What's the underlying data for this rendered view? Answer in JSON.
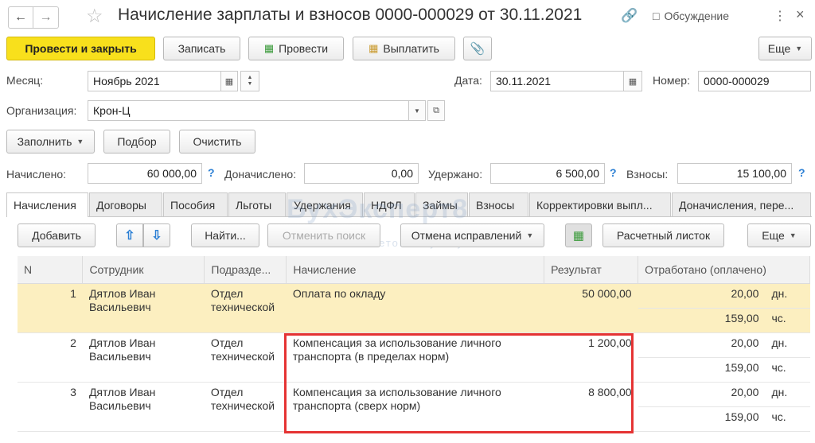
{
  "title": "Начисление зарплаты и взносов 0000-000029 от 30.11.2021",
  "header": {
    "discuss": "Обсуждение"
  },
  "toolbar": {
    "post_close": "Провести и закрыть",
    "save": "Записать",
    "post": "Провести",
    "pay": "Выплатить",
    "more": "Еще"
  },
  "fields": {
    "month_label": "Месяц:",
    "month_value": "Ноябрь 2021",
    "date_label": "Дата:",
    "date_value": "30.11.2021",
    "number_label": "Номер:",
    "number_value": "0000-000029",
    "org_label": "Организация:",
    "org_value": "Крон-Ц"
  },
  "actions": {
    "fill": "Заполнить",
    "select": "Подбор",
    "clear": "Очистить"
  },
  "totals": {
    "accrued_label": "Начислено:",
    "accrued_value": "60 000,00",
    "extra_label": "Доначислено:",
    "extra_value": "0,00",
    "withheld_label": "Удержано:",
    "withheld_value": "6 500,00",
    "contrib_label": "Взносы:",
    "contrib_value": "15 100,00",
    "help": "?"
  },
  "tabs": [
    "Начисления",
    "Договоры",
    "Пособия",
    "Льготы",
    "Удержания",
    "НДФЛ",
    "Займы",
    "Взносы",
    "Корректировки выпл...",
    "Доначисления, пере..."
  ],
  "tab_toolbar": {
    "add": "Добавить",
    "find": "Найти...",
    "cancel_search": "Отменить поиск",
    "cancel_fix": "Отмена исправлений",
    "payslip": "Расчетный листок",
    "more": "Еще"
  },
  "watermark": {
    "main": "БухЭксперт8",
    "sub": "База ответов по учету в 1С"
  },
  "table": {
    "columns": [
      "N",
      "Сотрудник",
      "Подразде...",
      "Начисление",
      "Результат",
      "Отработано (оплачено)"
    ],
    "rows": [
      {
        "n": "1",
        "employee": "Дятлов Иван Васильевич",
        "dept": "Отдел технической",
        "accrual": "Оплата по окладу",
        "result": "50 000,00",
        "days": "20,00",
        "days_unit": "дн.",
        "hours": "159,00",
        "hours_unit": "чс."
      },
      {
        "n": "2",
        "employee": "Дятлов Иван Васильевич",
        "dept": "Отдел технической",
        "accrual": "Компенсация за использование личного транспорта (в пределах норм)",
        "result": "1 200,00",
        "days": "20,00",
        "days_unit": "дн.",
        "hours": "159,00",
        "hours_unit": "чс."
      },
      {
        "n": "3",
        "employee": "Дятлов Иван Васильевич",
        "dept": "Отдел технической",
        "accrual": "Компенсация за использование личного транспорта (сверх норм)",
        "result": "8 800,00",
        "days": "20,00",
        "days_unit": "дн.",
        "hours": "159,00",
        "hours_unit": "чс."
      }
    ]
  }
}
